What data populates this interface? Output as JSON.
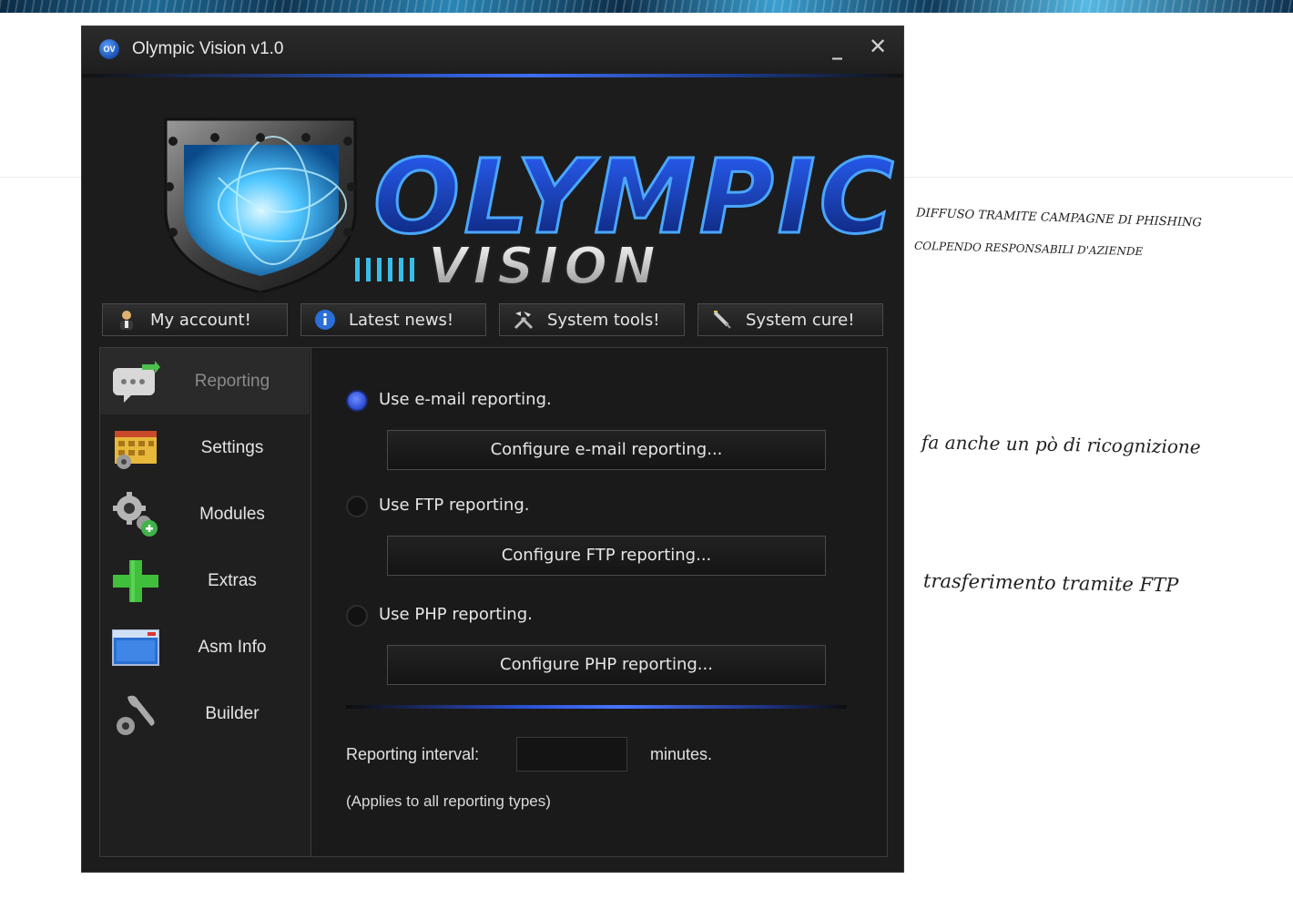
{
  "window": {
    "title": "Olympic Vision v1.0",
    "icon_text": "OV",
    "minimize_glyph": "_",
    "close_glyph": "✕"
  },
  "banner": {
    "title_top": "OLYMPIC",
    "title_bottom": "VISION"
  },
  "toolbar": {
    "my_account": "My account!",
    "latest_news": "Latest news!",
    "system_tools": "System tools!",
    "system_cure": "System cure!"
  },
  "sidebar": {
    "items": [
      {
        "label": "Reporting",
        "icon": "chat-bubble-icon",
        "active": true
      },
      {
        "label": "Settings",
        "icon": "calendar-icon",
        "active": false
      },
      {
        "label": "Modules",
        "icon": "gear-add-icon",
        "active": false
      },
      {
        "label": "Extras",
        "icon": "green-plus-icon",
        "active": false
      },
      {
        "label": "Asm Info",
        "icon": "window-icon",
        "active": false
      },
      {
        "label": "Builder",
        "icon": "wrench-gear-icon",
        "active": false
      }
    ]
  },
  "reporting": {
    "email": {
      "label": "Use e-mail reporting.",
      "button": "Configure e-mail reporting...",
      "selected": true
    },
    "ftp": {
      "label": "Use FTP reporting.",
      "button": "Configure FTP reporting...",
      "selected": false
    },
    "php": {
      "label": "Use PHP reporting.",
      "button": "Configure PHP reporting...",
      "selected": false
    },
    "interval_label": "Reporting interval:",
    "interval_value": "",
    "minutes_label": "minutes.",
    "note": "(Applies to all reporting types)"
  },
  "annotations": {
    "note1_line1": "DIFFUSO TRAMITE CAMPAGNE DI PHISHING",
    "note1_line2": "COLPENDO RESPONSABILI D'AZIENDE",
    "note2": "fa anche un pò di ricognizione",
    "note3": "trasferimento tramite FTP"
  },
  "colors": {
    "accent_blue": "#3e6ef0",
    "window_bg": "#1c1c1c",
    "text": "#e6e6e6"
  }
}
